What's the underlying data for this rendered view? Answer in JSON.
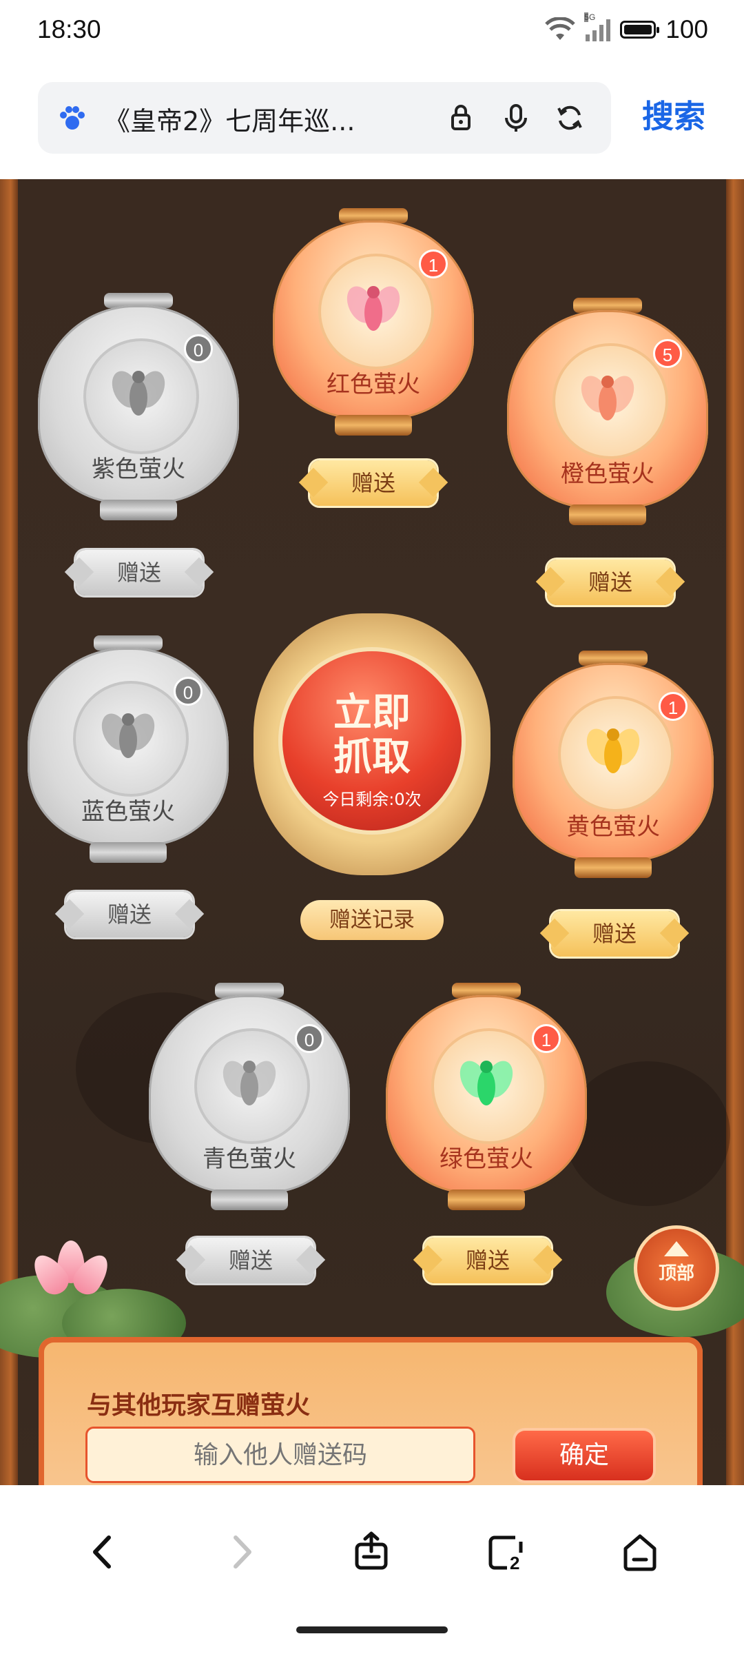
{
  "status_bar": {
    "time": "18:30",
    "battery": "100",
    "network_tag": "5G"
  },
  "browser": {
    "url_title": "《皇帝2》七周年巡...",
    "search_label": "搜索"
  },
  "lanterns": [
    {
      "id": "purple",
      "name": "紫色萤火",
      "count": "0",
      "gift_label": "赠送",
      "active": false,
      "fly_color": "#8a8a8a"
    },
    {
      "id": "red",
      "name": "红色萤火",
      "count": "1",
      "gift_label": "赠送",
      "active": true,
      "fly_color": "#f06d8a"
    },
    {
      "id": "orange",
      "name": "橙色萤火",
      "count": "5",
      "gift_label": "赠送",
      "active": true,
      "fly_color": "#f58a6a"
    },
    {
      "id": "blue",
      "name": "蓝色萤火",
      "count": "0",
      "gift_label": "赠送",
      "active": false,
      "fly_color": "#8a8a8a"
    },
    {
      "id": "yellow",
      "name": "黄色萤火",
      "count": "1",
      "gift_label": "赠送",
      "active": true,
      "fly_color": "#f5b21a"
    },
    {
      "id": "cyan",
      "name": "青色萤火",
      "count": "0",
      "gift_label": "赠送",
      "active": false,
      "fly_color": "#9a9a9a"
    },
    {
      "id": "green",
      "name": "绿色萤火",
      "count": "1",
      "gift_label": "赠送",
      "active": true,
      "fly_color": "#2bd66a"
    }
  ],
  "catch": {
    "title_line1": "立即",
    "title_line2": "抓取",
    "remaining": "今日剩余:0次"
  },
  "gift_record_label": "赠送记录",
  "top_button_label": "顶部",
  "exchange": {
    "title": "与其他玩家互赠萤火",
    "input_placeholder": "输入他人赠送码",
    "confirm_label": "确定"
  },
  "colors": {
    "accent": "#1a66e6",
    "background": "#3a2b20",
    "lantern_active": "#f0613a",
    "badge": "#ff5b46"
  },
  "nav": [
    "back-icon",
    "forward-icon",
    "share-icon",
    "tabs-icon",
    "home-icon"
  ],
  "tabs_count": "2"
}
